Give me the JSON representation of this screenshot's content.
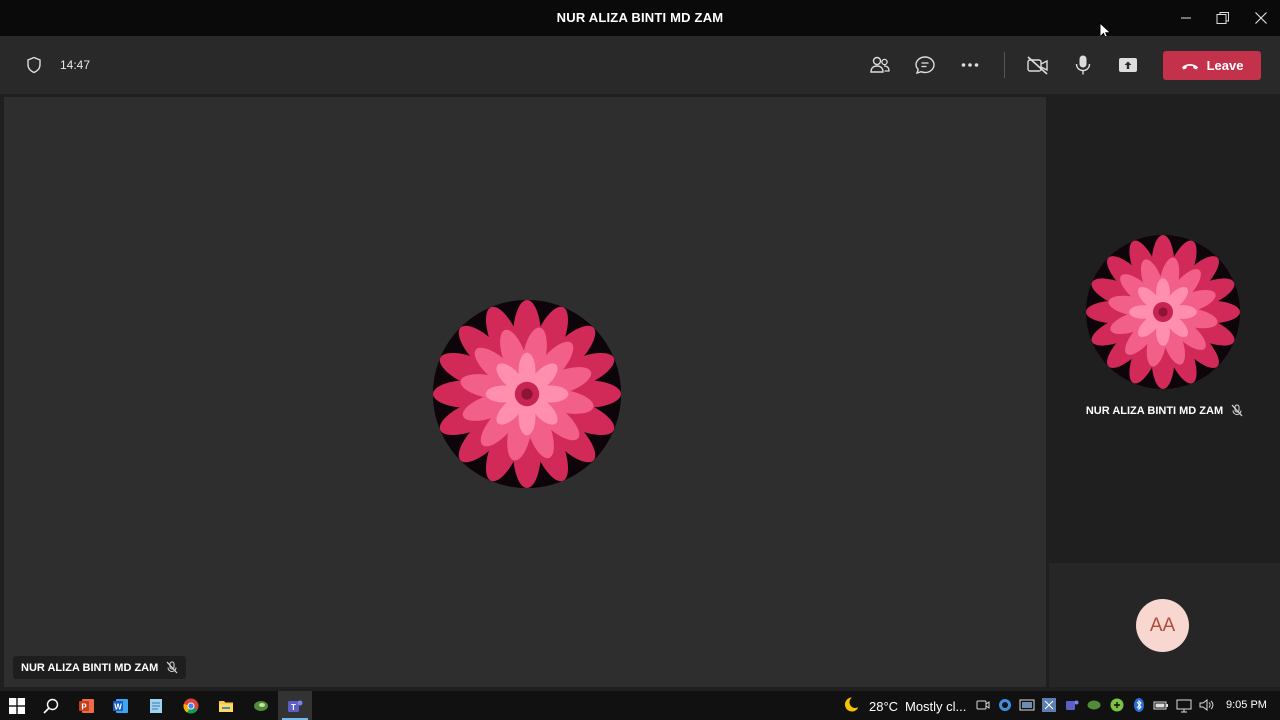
{
  "window": {
    "title": "NUR ALIZA BINTI MD ZAM"
  },
  "meeting": {
    "timer": "14:47",
    "leave_label": "Leave",
    "accent": "#c4314b"
  },
  "stage": {
    "participant_name": "NUR ALIZA BINTI MD ZAM"
  },
  "side_panel": {
    "participant_name": "NUR ALIZA BINTI MD ZAM",
    "self_initials": "AA"
  },
  "taskbar": {
    "apps": [
      "start-icon",
      "search-icon",
      "powerpoint-icon",
      "word-icon",
      "notepad-icon",
      "chrome-icon",
      "file-explorer-icon",
      "app-icon",
      "teams-icon"
    ],
    "weather_temp": "28°C",
    "weather_desc": "Mostly cl...",
    "clock": "9:05 PM"
  }
}
